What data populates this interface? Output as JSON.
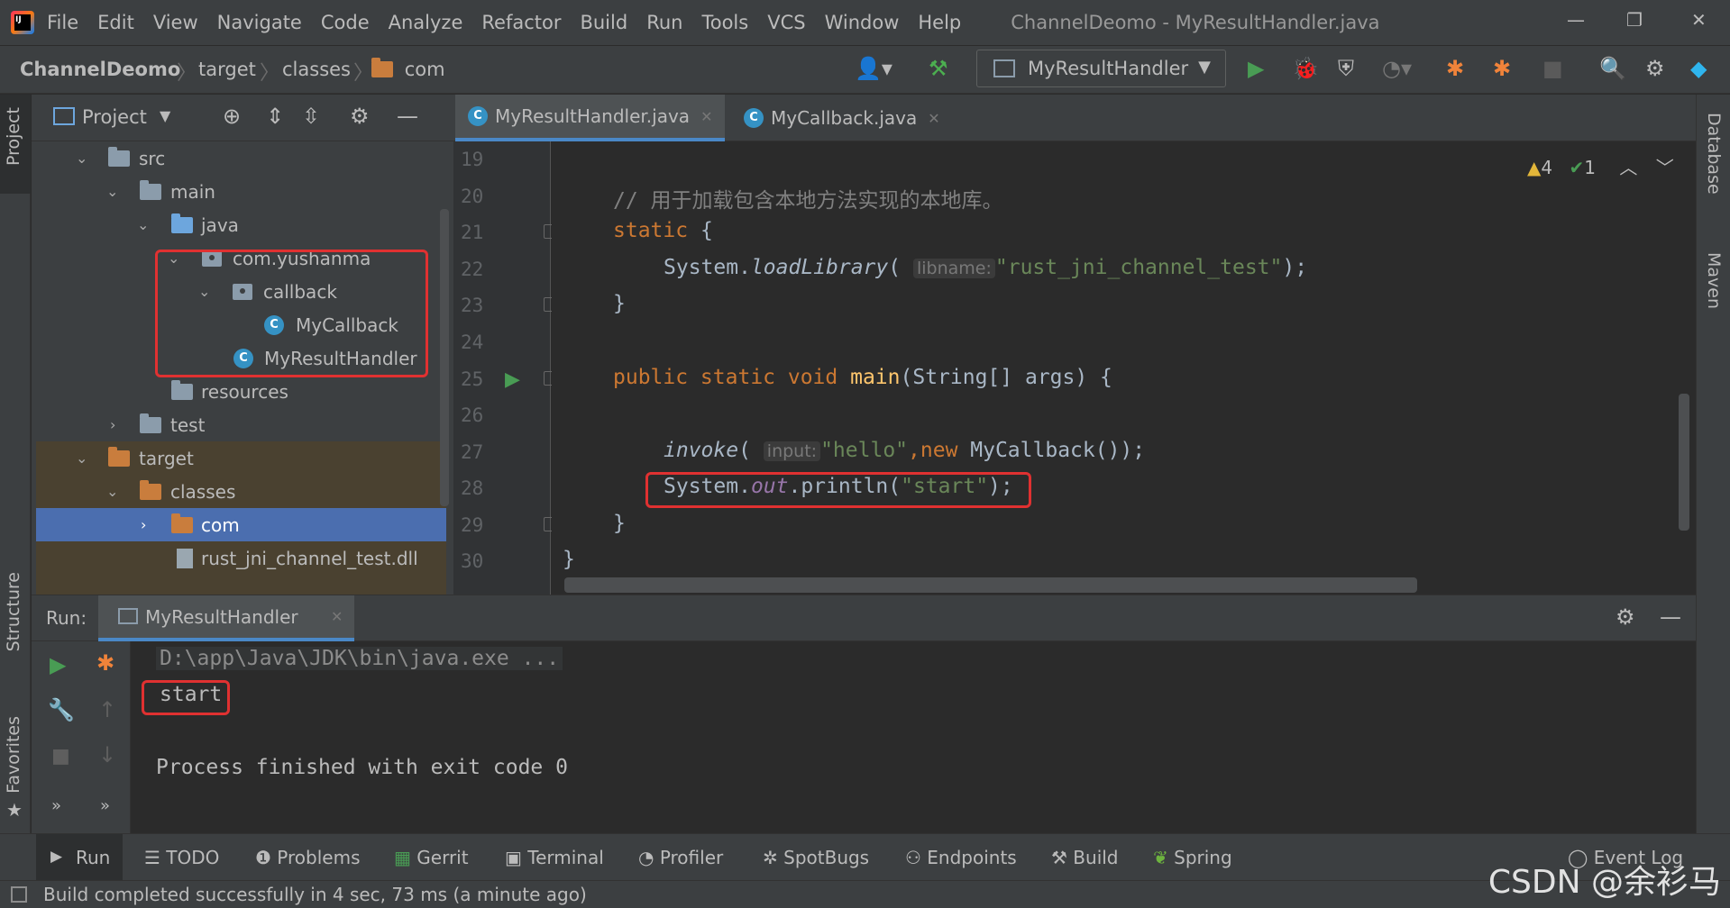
{
  "menu": [
    "File",
    "Edit",
    "View",
    "Navigate",
    "Code",
    "Analyze",
    "Refactor",
    "Build",
    "Run",
    "Tools",
    "VCS",
    "Window",
    "Help"
  ],
  "window_title": "ChannelDeomo - MyResultHandler.java",
  "window_controls": {
    "minimize": "—",
    "restore": "❐",
    "close": "✕"
  },
  "breadcrumbs": [
    "ChannelDeomo",
    "target",
    "classes",
    "com"
  ],
  "run_config": "MyResultHandler",
  "project_panel": {
    "title": "Project",
    "tree": [
      {
        "label": "src",
        "expanded": true
      },
      {
        "label": "main",
        "expanded": true
      },
      {
        "label": "java",
        "expanded": true
      },
      {
        "label": "com.yushanma",
        "expanded": true
      },
      {
        "label": "callback",
        "expanded": true
      },
      {
        "label": "MyCallback"
      },
      {
        "label": "MyResultHandler"
      },
      {
        "label": "resources"
      },
      {
        "label": "test",
        "expanded": false
      },
      {
        "label": "target",
        "expanded": true
      },
      {
        "label": "classes",
        "expanded": true
      },
      {
        "label": "com",
        "expanded": false,
        "selected": true
      },
      {
        "label": "rust_jni_channel_test.dll"
      }
    ]
  },
  "editor": {
    "tabs": [
      {
        "label": "MyResultHandler.java",
        "active": true
      },
      {
        "label": "MyCallback.java",
        "active": false
      }
    ],
    "inspections": {
      "warnings": "4",
      "ok": "1"
    },
    "line_numbers": [
      "19",
      "20",
      "21",
      "22",
      "23",
      "24",
      "25",
      "26",
      "27",
      "28",
      "29",
      "30"
    ],
    "code": {
      "l20_comment": "// 用于加载包含本地方法实现的本地库。",
      "l21_static": "static",
      "l21_brace": " {",
      "l22_system": "System.",
      "l22_method": "loadLibrary",
      "l22_open": "( ",
      "l22_hint": "libname:",
      "l22_string": "\"rust_jni_channel_test\"",
      "l22_close": ");",
      "l23": "}",
      "l25_mods": "public static void ",
      "l25_name": "main",
      "l25_rest": "(String[] args) {",
      "l27_method": "invoke",
      "l27_open": "( ",
      "l27_hint": "input:",
      "l27_string": "\"hello\"",
      "l27_comma": ",",
      "l27_new": "new ",
      "l27_rest": "MyCallback());",
      "l28_system": "System.",
      "l28_field": "out",
      "l28_call": ".println(",
      "l28_string": "\"start\"",
      "l28_close": ");",
      "l29": "}",
      "l30": "}"
    }
  },
  "run_panel": {
    "label": "Run:",
    "tab": "MyResultHandler",
    "console": [
      "D:\\app\\Java\\JDK\\bin\\java.exe ...",
      "start",
      "",
      "Process finished with exit code 0"
    ]
  },
  "left_strip": {
    "project": "Project",
    "structure": "Structure",
    "favorites": "Favorites"
  },
  "right_strip": {
    "database": "Database",
    "maven": "Maven"
  },
  "bottom_tools": [
    "Run",
    "TODO",
    "Problems",
    "Gerrit",
    "Terminal",
    "Profiler",
    "SpotBugs",
    "Endpoints",
    "Build",
    "Spring"
  ],
  "event_log": "Event Log",
  "status": "Build completed successfully in 4 sec, 73 ms (a minute ago)",
  "watermark": "CSDN @余衫马",
  "colors": {
    "accent": "#4a88c7",
    "highlight": "#e03131",
    "selection": "#4b6eaf"
  }
}
